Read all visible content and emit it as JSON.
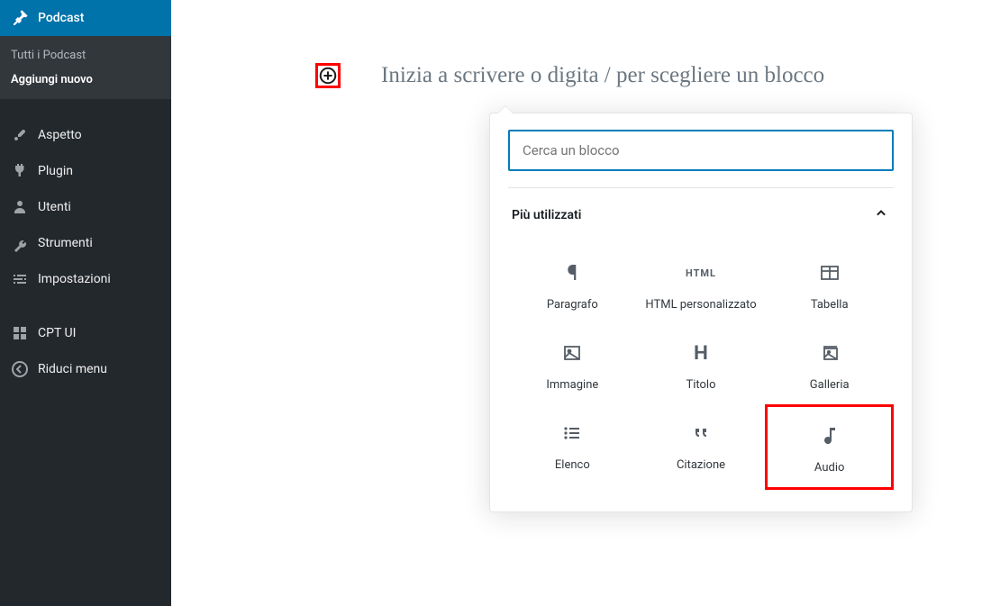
{
  "sidebar": {
    "current": {
      "label": "Podcast"
    },
    "submenu": {
      "all": "Tutti i Podcast",
      "add": "Aggiungi nuovo"
    },
    "items": [
      {
        "label": "Aspetto"
      },
      {
        "label": "Plugin"
      },
      {
        "label": "Utenti"
      },
      {
        "label": "Strumenti"
      },
      {
        "label": "Impostazioni"
      },
      {
        "label": "CPT UI"
      },
      {
        "label": "Riduci menu"
      }
    ]
  },
  "editor": {
    "prompt": "Inizia a scrivere o digita / per scegliere un blocco"
  },
  "inserter": {
    "search_placeholder": "Cerca un blocco",
    "section_title": "Più utilizzati",
    "blocks": {
      "paragraph": "Paragrafo",
      "html": "HTML personalizzato",
      "table": "Tabella",
      "image": "Immagine",
      "heading": "Titolo",
      "gallery": "Galleria",
      "list": "Elenco",
      "quote": "Citazione",
      "audio": "Audio"
    }
  }
}
